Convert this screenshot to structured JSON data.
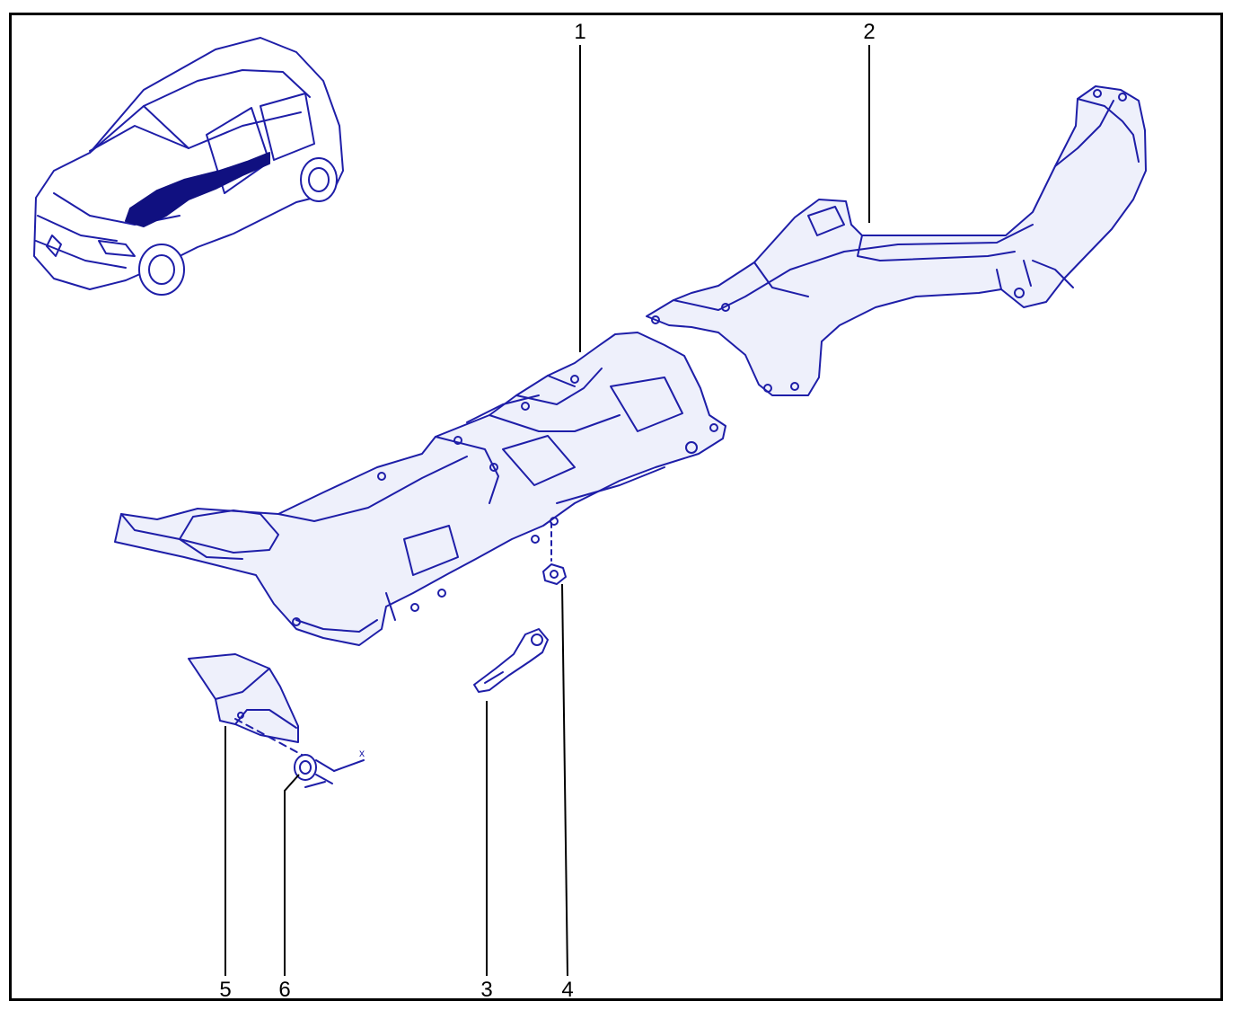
{
  "diagram": {
    "callouts": [
      "1",
      "2",
      "3",
      "4",
      "5",
      "6"
    ],
    "dimension_label": "x"
  },
  "colors": {
    "line": "#1e1ea8",
    "fill": "#eef0fb",
    "highlight": "#101080",
    "leader": "#000000",
    "frame": "#000000"
  }
}
